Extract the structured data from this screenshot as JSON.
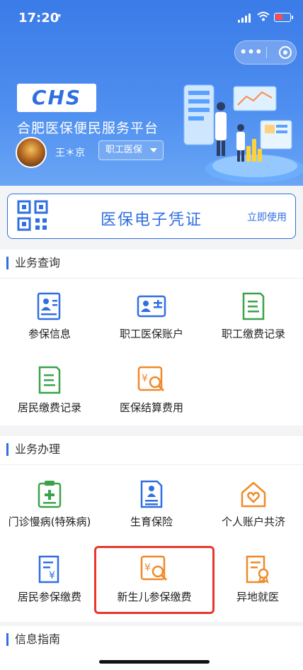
{
  "status_bar": {
    "time": "17:20",
    "location_icon": "arrow-icon"
  },
  "capsule": {
    "more_icon": "more-icon",
    "close_icon": "target-icon"
  },
  "header": {
    "logo_text": "CHS",
    "platform_name": "合肥医保便民服务平台",
    "user_name": "王＊京",
    "user_type": "职工医保"
  },
  "voucher": {
    "title": "医保电子凭证",
    "action": "立即使用"
  },
  "sections": {
    "query": {
      "title": "业务查询",
      "items": [
        {
          "label": "参保信息",
          "icon": "person-card-icon",
          "color": "#2f6fe0"
        },
        {
          "label": "职工医保账户",
          "icon": "id-card-icon",
          "color": "#2f6fe0"
        },
        {
          "label": "职工缴费记录",
          "icon": "receipt-icon",
          "color": "#3aa34a"
        },
        {
          "label": "居民缴费记录",
          "icon": "receipt-icon",
          "color": "#3aa34a"
        },
        {
          "label": "医保结算费用",
          "icon": "yuan-search-icon",
          "color": "#ef8a2a"
        }
      ]
    },
    "handle": {
      "title": "业务办理",
      "items": [
        {
          "label": "门诊慢病(特殊病)",
          "icon": "clipboard-plus-icon",
          "color": "#3aa34a"
        },
        {
          "label": "生育保险",
          "icon": "baby-doc-icon",
          "color": "#2f6fe0"
        },
        {
          "label": "个人账户共济",
          "icon": "house-heart-icon",
          "color": "#ef8a2a"
        },
        {
          "label": "居民参保缴费",
          "icon": "yuan-doc-icon",
          "color": "#2f6fe0"
        },
        {
          "label": "新生儿参保缴费",
          "icon": "yuan-search-icon",
          "color": "#ef8a2a"
        },
        {
          "label": "异地就医",
          "icon": "doc-badge-icon",
          "color": "#ef8a2a"
        }
      ]
    },
    "guide": {
      "title": "信息指南"
    }
  }
}
